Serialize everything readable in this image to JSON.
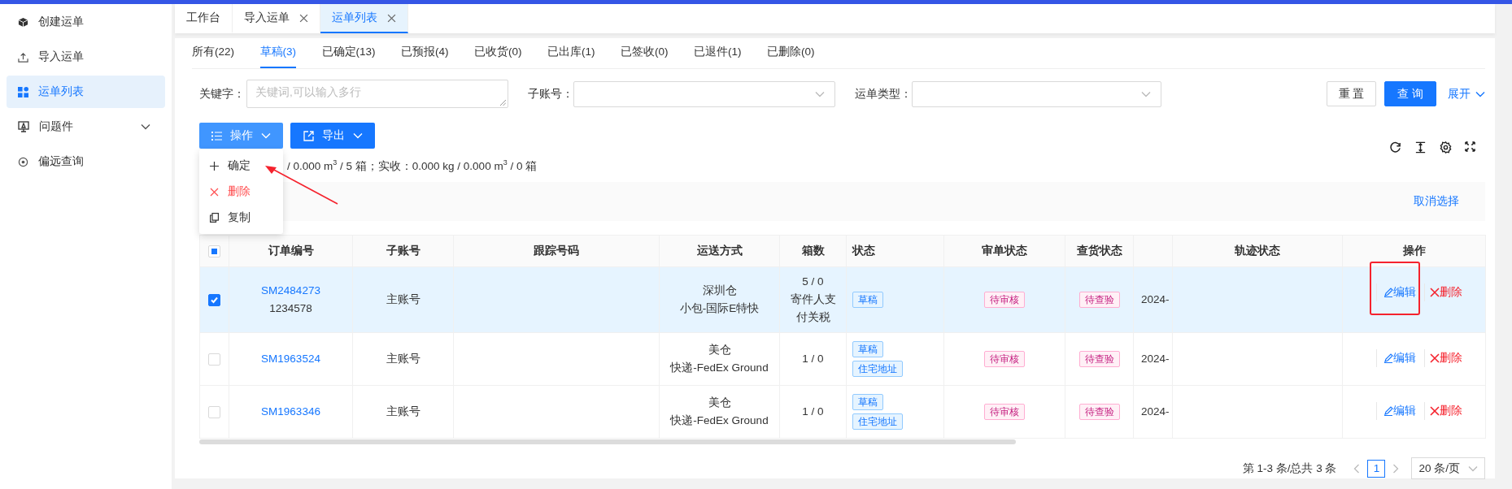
{
  "sidebar": {
    "items": [
      {
        "label": "创建运单",
        "kind": "link",
        "selected": false
      },
      {
        "label": "导入运单",
        "kind": "link",
        "selected": false
      },
      {
        "label": "运单列表",
        "kind": "link",
        "selected": true
      },
      {
        "label": "问题件",
        "kind": "group",
        "selected": false,
        "expanded": false
      },
      {
        "label": "偏远查询",
        "kind": "link",
        "selected": false
      }
    ]
  },
  "tabs": [
    {
      "label": "工作台",
      "closable": false,
      "selected": false
    },
    {
      "label": "导入运单",
      "closable": true,
      "selected": false
    },
    {
      "label": "运单列表",
      "closable": true,
      "selected": true
    }
  ],
  "status_tabs": [
    {
      "label": "所有(22)",
      "selected": false
    },
    {
      "label": "草稿(3)",
      "selected": true
    },
    {
      "label": "已确定(13)",
      "selected": false
    },
    {
      "label": "已预报(4)",
      "selected": false
    },
    {
      "label": "已收货(0)",
      "selected": false
    },
    {
      "label": "已出库(1)",
      "selected": false
    },
    {
      "label": "已签收(0)",
      "selected": false
    },
    {
      "label": "已退件(1)",
      "selected": false
    },
    {
      "label": "已删除(0)",
      "selected": false
    }
  ],
  "filters": {
    "keyword": {
      "label": "关键字：",
      "placeholder": "关键词,可以输入多行"
    },
    "sub_account": {
      "label": "子账号："
    },
    "waybill_type": {
      "label": "运单类型："
    }
  },
  "filter_buttons": {
    "reset": "重 置",
    "search": "查 询",
    "expand": "展开"
  },
  "actions": {
    "operations": {
      "label": "操作",
      "open": true,
      "menu": [
        {
          "label": "确定",
          "kind": "confirm",
          "annotated": true
        },
        {
          "label": "删除",
          "kind": "delete",
          "annotated": false
        },
        {
          "label": "复制",
          "kind": "copy",
          "annotated": false
        }
      ]
    },
    "export": {
      "label": "导出"
    }
  },
  "summary": "/ 0.000 m$^{3}$ / 5 箱；实收：0.000 kg / 0.000 m$^{3}$ / 0 箱",
  "selection_bar": {
    "clear": "取消选择"
  },
  "table": {
    "select_all": {
      "checked": false,
      "indeterminate": true
    },
    "columns": [
      {
        "label": "订单编号"
      },
      {
        "label": "子账号"
      },
      {
        "label": "跟踪号码"
      },
      {
        "label": "运送方式"
      },
      {
        "label": "箱数"
      },
      {
        "label": "状态"
      },
      {
        "label": "审单状态"
      },
      {
        "label": "查货状态"
      },
      {},
      {
        "label": "轨迹状态"
      },
      {
        "label": "操作"
      }
    ],
    "rows": [
      {
        "selected": true,
        "order_no": "SM2484273",
        "reference": "1234578",
        "sub_account": "主账号",
        "shipping": [
          "深圳仓",
          "小包-国际E特快"
        ],
        "boxes": "5 / 0",
        "boxes_note": "寄件人支付关税",
        "status_tags": [
          {
            "label": "草稿"
          }
        ],
        "review_status": "待审核",
        "inspection_status": "待查验",
        "column_9": "2024-",
        "actions": [
          {
            "label": "编辑",
            "kind": "edit",
            "annotated": true
          },
          {
            "label": "删除",
            "kind": "delete",
            "annotated": false
          }
        ]
      },
      {
        "selected": false,
        "order_no": "SM1963524",
        "sub_account": "主账号",
        "shipping": [
          "美仓",
          "快递-FedEx Ground"
        ],
        "boxes": "1 / 0",
        "status_tags": [
          {
            "label": "草稿"
          },
          {
            "label": "住宅地址"
          }
        ],
        "review_status": "待审核",
        "inspection_status": "待查验",
        "column_9": "2024-",
        "actions": [
          {
            "label": "编辑",
            "kind": "edit",
            "annotated": false
          },
          {
            "label": "删除",
            "kind": "delete",
            "annotated": false
          }
        ]
      },
      {
        "selected": false,
        "order_no": "SM1963346",
        "sub_account": "主账号",
        "shipping": [
          "美仓",
          "快递-FedEx Ground"
        ],
        "boxes": "1 / 0",
        "status_tags": [
          {
            "label": "草稿"
          },
          {
            "label": "住宅地址"
          }
        ],
        "review_status": "待审核",
        "inspection_status": "待查验",
        "column_9": "2024-",
        "actions": [
          {
            "label": "编辑",
            "kind": "edit",
            "annotated": false
          },
          {
            "label": "删除",
            "kind": "delete",
            "annotated": false
          }
        ]
      }
    ]
  },
  "pagination": {
    "summary": "第 1-3 条/总共 3 条",
    "prev_disabled": true,
    "next_disabled": true,
    "pages": [
      {
        "label": "1",
        "selected": true
      }
    ],
    "page_size": "20 条/页"
  }
}
